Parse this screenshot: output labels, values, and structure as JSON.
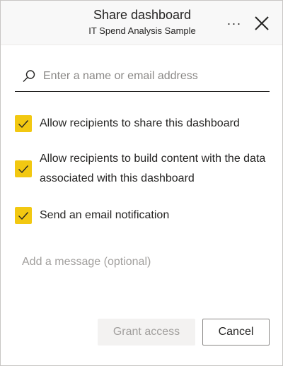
{
  "header": {
    "title": "Share dashboard",
    "subtitle": "IT Spend Analysis Sample",
    "more_label": "···"
  },
  "search": {
    "placeholder": "Enter a name or email address",
    "value": ""
  },
  "options": [
    {
      "label": "Allow recipients to share this dashboard",
      "checked": true
    },
    {
      "label": "Allow recipients to build content with the data associated with this dashboard",
      "checked": true
    },
    {
      "label": "Send an email notification",
      "checked": true
    }
  ],
  "message": {
    "placeholder": "Add a message (optional)",
    "value": ""
  },
  "buttons": {
    "grant": "Grant access",
    "cancel": "Cancel"
  },
  "colors": {
    "checkbox_fill": "#f2c811",
    "header_bg": "#f8f8f8",
    "disabled_button_bg": "#f3f2f1"
  },
  "icons": {
    "search": "search-icon",
    "more": "more-options-icon",
    "close": "close-icon",
    "check": "checkmark-icon"
  }
}
